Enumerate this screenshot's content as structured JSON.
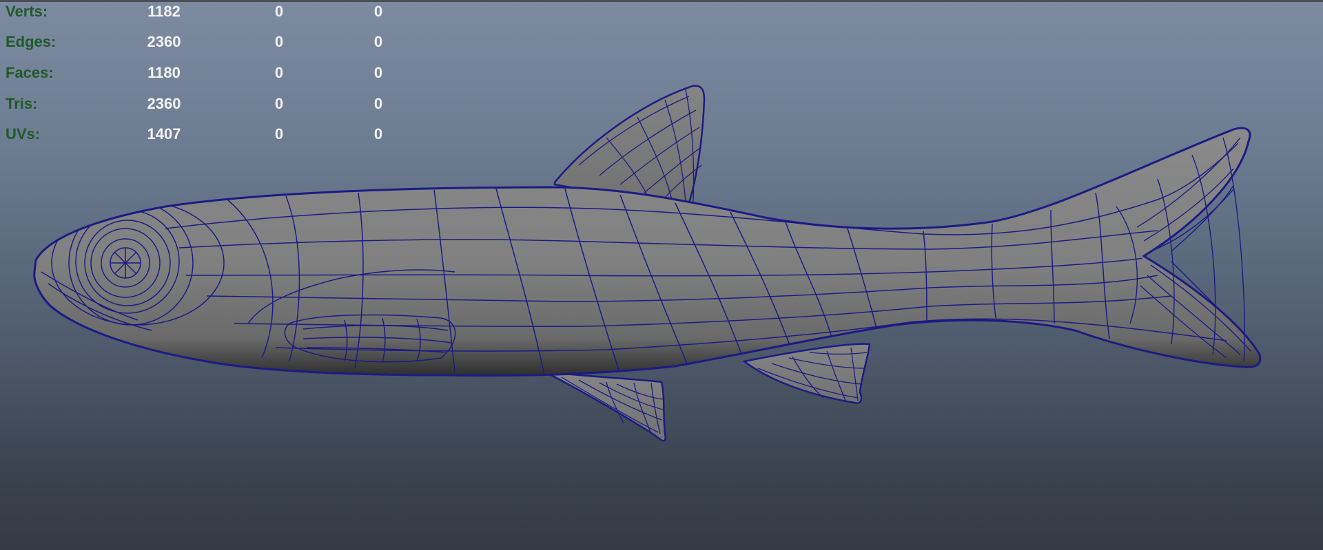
{
  "viewport": {
    "name": "3D perspective viewport",
    "model_wire_color": "#1b1b84",
    "model_shade_color": "#7f7f7f"
  },
  "hud": {
    "rows": [
      {
        "label": "Verts:",
        "values": [
          "1182",
          "0",
          "0"
        ]
      },
      {
        "label": "Edges:",
        "values": [
          "2360",
          "0",
          "0"
        ]
      },
      {
        "label": "Faces:",
        "values": [
          "1180",
          "0",
          "0"
        ]
      },
      {
        "label": "Tris:",
        "values": [
          "2360",
          "0",
          "0"
        ]
      },
      {
        "label": "UVs:",
        "values": [
          "1407",
          "0",
          "0"
        ]
      }
    ]
  }
}
